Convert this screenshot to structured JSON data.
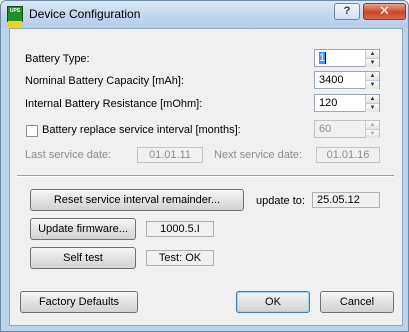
{
  "window": {
    "title": "Device Configuration",
    "help_label": "?",
    "close_label": "✕",
    "app_icon_text": "UPS"
  },
  "fields": {
    "battery_type": {
      "label": "Battery Type:",
      "value": "1"
    },
    "capacity": {
      "label": "Nominal Battery Capacity [mAh]:",
      "value": "3400"
    },
    "resistance": {
      "label": "Internal Battery Resistance [mOhm]:",
      "value": "120"
    },
    "replace_interval": {
      "label": "Battery replace service interval [months]:",
      "value": "60",
      "checked": false
    },
    "last_service": {
      "label": "Last service date:",
      "value": "01.01.11"
    },
    "next_service": {
      "label": "Next service date:",
      "value": "01.01.16"
    }
  },
  "actions": {
    "reset_label": "Reset service interval remainder...",
    "update_to_label": "update to:",
    "update_to_value": "25.05.12",
    "update_firmware_label": "Update firmware...",
    "firmware_version": "1000.5.I",
    "self_test_label": "Self test",
    "self_test_result": "Test: OK"
  },
  "footer": {
    "factory_defaults": "Factory Defaults",
    "ok": "OK",
    "cancel": "Cancel"
  }
}
